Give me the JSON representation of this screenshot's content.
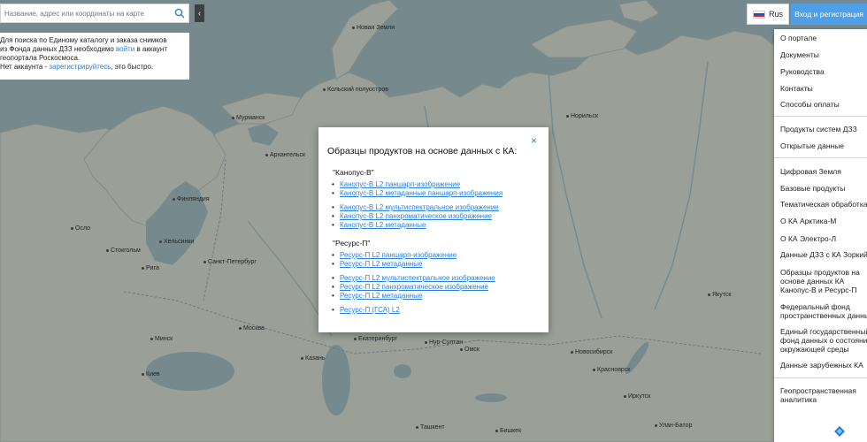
{
  "search": {
    "placeholder": "Название, адрес или координаты на карте"
  },
  "info": {
    "line1": "Для поиска по Единому каталогу и заказа снимков",
    "line2a": "из Фонда данных ДЗЗ необходимо ",
    "login_link": "войти",
    "line2b": " в аккаунт",
    "line3": "геопортала Роскосмоса.",
    "line4a": "Нет аккаунта - ",
    "register_link": "зарегистрируйтесь",
    "line4b": ", это быстро."
  },
  "header": {
    "language": "Rus",
    "login_button": "Вход и регистрация"
  },
  "menu": {
    "items": [
      "О портале",
      "Документы",
      "Руководства",
      "Контакты",
      "Способы оплаты",
      "Продукты систем ДЗЗ",
      "Открытые данные",
      "Цифровая Земля",
      "Базовые продукты",
      "Тематическая обработка",
      "О КА Арктика-М",
      "О КА Электро-Л",
      "Данные ДЗЗ с КА Зоркий",
      "Образцы продуктов на",
      "основе данных КА",
      "Канопус-В и Ресурс-П",
      "Федеральный фонд",
      "пространственных данных",
      "Единый государственный",
      "фонд данных о состоянии",
      "окружающей среды",
      "Данные зарубежных КА",
      "Геопространственная",
      "аналитика"
    ]
  },
  "modal": {
    "title": "Образцы продуктов на основе данных с КА:",
    "close": "×",
    "group1": "\"Канопус-В\"",
    "group1_links": [
      "Канопус-В L2 паншарп-изображение",
      "Канопус-В L2 метаданные паншарп-изображения",
      "Канопус-В L2 мультиспектральное изображение",
      "Канопус-В L2 панхроматическое изображение",
      "Канопус-В L2 метаданные"
    ],
    "group2": "\"Ресурс-П\"",
    "group2_links": [
      "Ресурс-П L2 паншарп-изображение",
      "Ресурс-П L2 метаданные",
      "Ресурс-П L2 мультиспектральное изображение",
      "Ресурс-П L2 панхроматическое изображение",
      "Ресурс-П L2 метаданные",
      "Ресурс-П (ГСА) L2"
    ]
  },
  "map_labels": [
    "Новая Земля",
    "Кольский полуостров",
    "Финляндия",
    "Санкт-Петербург",
    "Москва",
    "Нур-Султан",
    "Ташкент",
    "Бишкек",
    "Улан-Батор",
    "Новосибирск",
    "Красноярск",
    "Иркутск",
    "Якутск",
    "Екатеринбург",
    "Омск",
    "Казань",
    "Киев",
    "Минск",
    "Рига",
    "Хельсинки",
    "Стокгольм",
    "Осло",
    "Норильск",
    "Мурманск",
    "Архангельск"
  ],
  "colors": {
    "water": "#a9c6cc",
    "land": "#dde5d9",
    "accent": "#4e9ee8",
    "link": "#2b7fd9"
  },
  "icons": {
    "search": "search-icon",
    "collapse": "chevron-left-icon",
    "close": "close-icon",
    "layers": "layers-icon",
    "flag": "russia-flag-icon"
  }
}
